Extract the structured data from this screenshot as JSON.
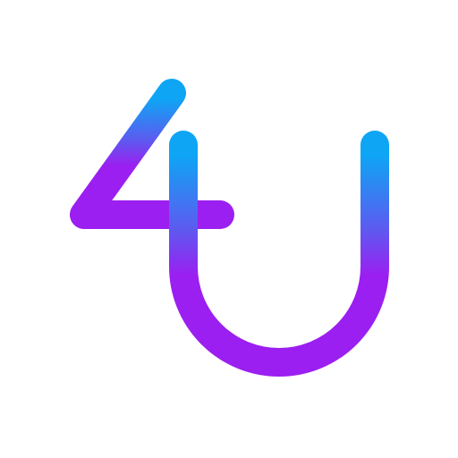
{
  "logo": {
    "lettering": "4U",
    "icon": "4u-logo-icon",
    "colors": {
      "gradient_top": "#0ea5f5",
      "gradient_mid": "#5b5cf0",
      "gradient_bottom": "#9b1ff0",
      "background": "#ffffff"
    }
  }
}
